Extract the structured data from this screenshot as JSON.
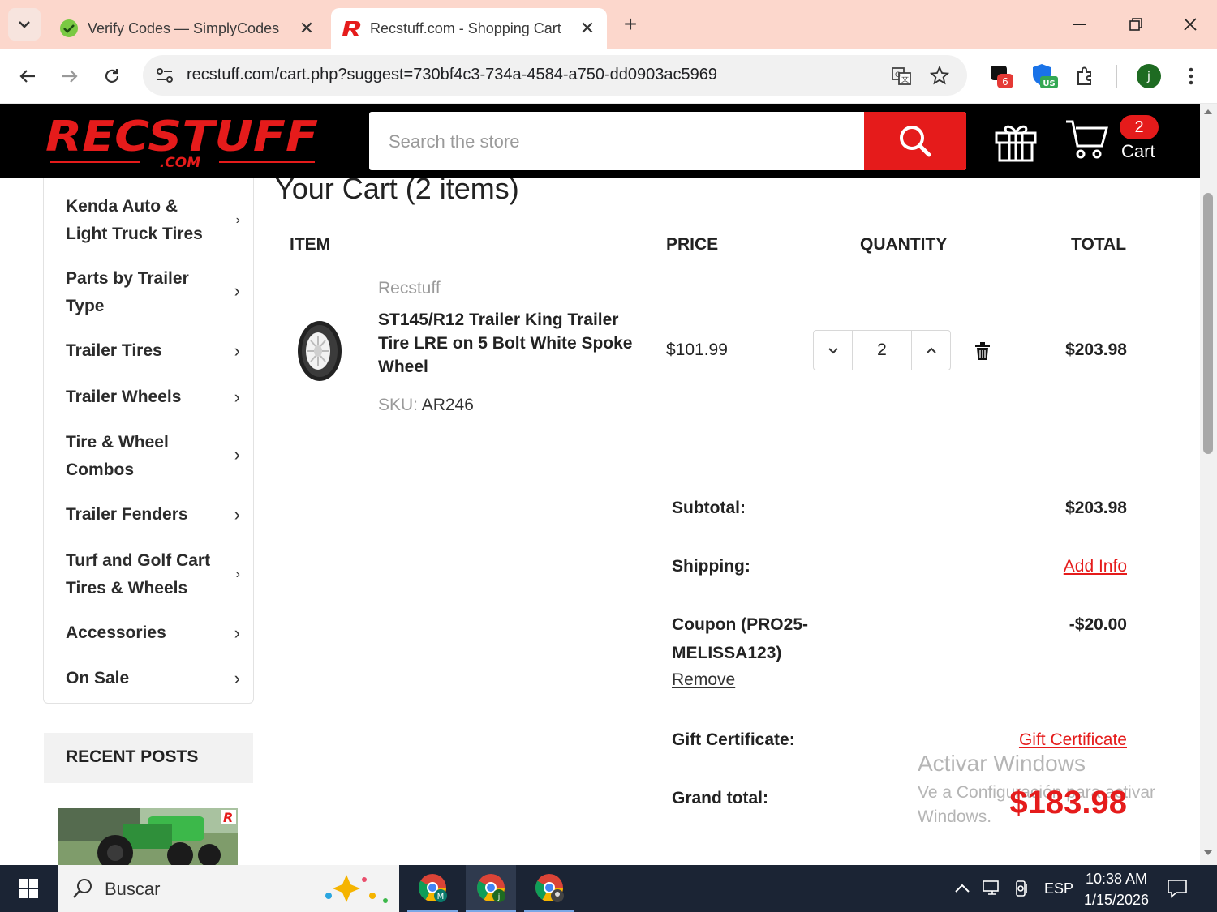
{
  "browser": {
    "tabs": [
      {
        "title": "Verify Codes — SimplyCodes",
        "active": false
      },
      {
        "title": "Recstuff.com - Shopping Cart",
        "active": true
      }
    ],
    "url": "recstuff.com/cart.php?suggest=730bf4c3-734a-4584-a750-dd0903ac5969",
    "extensions": [
      {
        "icon": "ext-badge-icon",
        "badge": "6"
      },
      {
        "icon": "ext-shield-icon",
        "badge": "US"
      },
      {
        "icon": "puzzle-icon"
      }
    ],
    "profile_initial": "j"
  },
  "header": {
    "logo_text": "RECSTUFF",
    "logo_sub": ".COM",
    "search_placeholder": "Search the store",
    "cart_count": "2",
    "cart_label": "Cart"
  },
  "sidebar": {
    "items": [
      {
        "label": "Kenda Auto & Light Truck Tires"
      },
      {
        "label": "Parts by Trailer Type"
      },
      {
        "label": "Trailer Tires"
      },
      {
        "label": "Trailer Wheels"
      },
      {
        "label": "Tire & Wheel Combos"
      },
      {
        "label": "Trailer Fenders"
      },
      {
        "label": "Turf and Golf Cart Tires & Wheels"
      },
      {
        "label": "Accessories"
      },
      {
        "label": "On Sale"
      }
    ],
    "recent_posts_title": "RECENT POSTS"
  },
  "cart": {
    "title": "Your Cart (2 items)",
    "columns": {
      "item": "ITEM",
      "price": "PRICE",
      "quantity": "QUANTITY",
      "total": "TOTAL"
    },
    "line": {
      "brand": "Recstuff",
      "name": "ST145/R12 Trailer King Trailer Tire LRE on 5 Bolt White Spoke Wheel",
      "sku_label": "SKU:",
      "sku": "AR246",
      "price": "$101.99",
      "quantity": "2",
      "total": "$203.98"
    },
    "summary": {
      "subtotal_label": "Subtotal:",
      "subtotal": "$203.98",
      "shipping_label": "Shipping:",
      "shipping_link": "Add Info",
      "coupon_label": "Coupon (PRO25-MELISSA123)",
      "coupon_remove": "Remove",
      "coupon_value": "-$20.00",
      "gift_label": "Gift Certificate:",
      "gift_link": "Gift Certificate",
      "grand_label": "Grand total:",
      "grand_total": "$183.98"
    }
  },
  "watermark": {
    "line1": "Activar Windows",
    "line2": "Ve a Configuración para activar Windows."
  },
  "taskbar": {
    "search_label": "Buscar",
    "language": "ESP",
    "time": "10:38 AM",
    "date": "1/15/2026"
  },
  "colors": {
    "brand_red": "#e51b1b",
    "header_bg": "#000000",
    "tabbar_bg": "#fcd7cc"
  }
}
